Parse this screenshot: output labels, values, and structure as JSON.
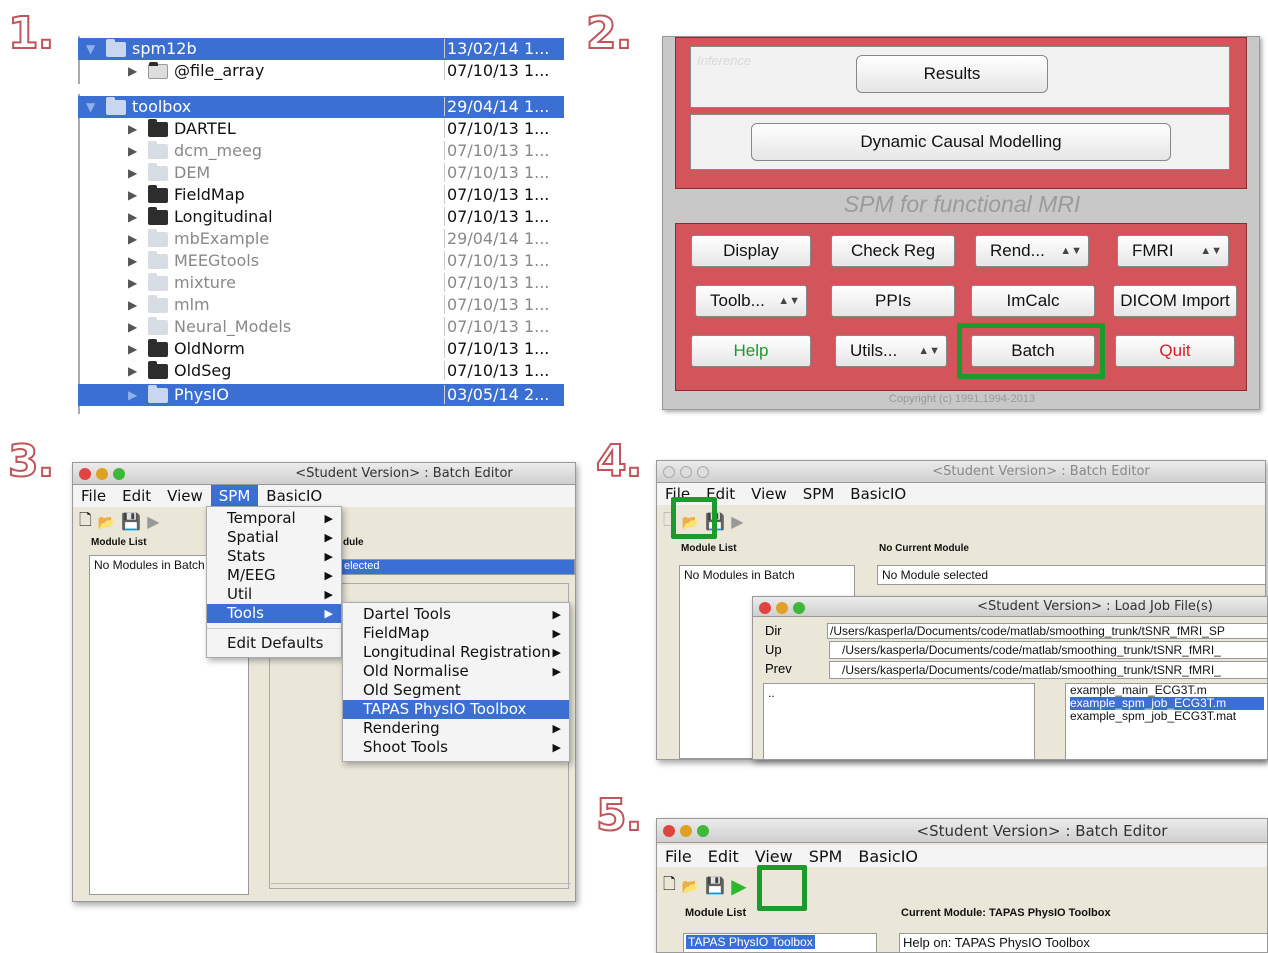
{
  "steps": [
    "1.",
    "2.",
    "3.",
    "4.",
    "5."
  ],
  "panel1": {
    "rows": [
      {
        "name": "spm12b",
        "date": "13/02/14 1...",
        "sel": true,
        "expanded": true,
        "indent": 0
      },
      {
        "name": "@file_array",
        "date": "07/10/13 1...",
        "indent": 1
      },
      {
        "name": "toolbox",
        "date": "29/04/14 1...",
        "sel": true,
        "expanded": true,
        "indent": 0
      },
      {
        "name": "DARTEL",
        "date": "07/10/13 1...",
        "indent": 1
      },
      {
        "name": "dcm_meeg",
        "date": "07/10/13 1...",
        "indent": 1,
        "dim": true
      },
      {
        "name": "DEM",
        "date": "07/10/13 1...",
        "indent": 1,
        "dim": true
      },
      {
        "name": "FieldMap",
        "date": "07/10/13 1...",
        "indent": 1
      },
      {
        "name": "Longitudinal",
        "date": "07/10/13 1...",
        "indent": 1
      },
      {
        "name": "mbExample",
        "date": "29/04/14 1...",
        "indent": 1,
        "dim": true
      },
      {
        "name": "MEEGtools",
        "date": "07/10/13 1...",
        "indent": 1,
        "dim": true
      },
      {
        "name": "mixture",
        "date": "07/10/13 1...",
        "indent": 1,
        "dim": true
      },
      {
        "name": "mlm",
        "date": "07/10/13 1...",
        "indent": 1,
        "dim": true
      },
      {
        "name": "Neural_Models",
        "date": "07/10/13 1...",
        "indent": 1,
        "dim": true
      },
      {
        "name": "OldNorm",
        "date": "07/10/13 1...",
        "indent": 1
      },
      {
        "name": "OldSeg",
        "date": "07/10/13 1...",
        "indent": 1
      },
      {
        "name": "PhysIO",
        "date": "03/05/14 2...",
        "indent": 1,
        "sel": true
      }
    ]
  },
  "panel2": {
    "inference_label": "Inference",
    "results": "Results",
    "dcm": "Dynamic Causal Modelling",
    "section_title": "SPM for functional MRI",
    "buttons": {
      "display": "Display",
      "checkreg": "Check Reg",
      "rend": "Rend...",
      "fmri": "FMRI",
      "toolb": "Toolb...",
      "ppis": "PPIs",
      "imcalc": "ImCalc",
      "dicom": "DICOM Import",
      "help": "Help",
      "utils": "Utils...",
      "batch": "Batch",
      "quit": "Quit"
    },
    "copyright": "Copyright (c) 1991,1994-2013"
  },
  "window_title": "<Student Version> : Batch Editor",
  "menus": {
    "file": "File",
    "edit": "Edit",
    "view": "View",
    "spm": "SPM",
    "basicio": "BasicIO"
  },
  "panel3": {
    "module_list": "Module List",
    "no_modules": "No Modules in Batch",
    "dule": "dule",
    "elected": "elected",
    "spm_menu": [
      "Temporal",
      "Spatial",
      "Stats",
      "M/EEG",
      "Util",
      "Tools"
    ],
    "edit_defaults": "Edit Defaults",
    "tools_menu": [
      "Dartel Tools",
      "FieldMap",
      "Longitudinal Registration",
      "Old Normalise",
      "Old Segment",
      "TAPAS PhysIO Toolbox",
      "Rendering",
      "Shoot Tools"
    ]
  },
  "panel4": {
    "module_list": "Module List",
    "no_current": "No Current Module",
    "no_modules": "No Modules in Batch",
    "no_selected": "No Module selected",
    "load_title": "<Student Version> : Load Job File(s)",
    "dir": "Dir",
    "up": "Up",
    "prev": "Prev",
    "path1": "/Users/kasperla/Documents/code/matlab/smoothing_trunk/tSNR_fMRI_SP",
    "path2": "/Users/kasperla/Documents/code/matlab/smoothing_trunk/tSNR_fMRI_",
    "path3": "/Users/kasperla/Documents/code/matlab/smoothing_trunk/tSNR_fMRI_",
    "dotdot": "..",
    "files": [
      "example_main_ECG3T.m",
      "example_spm_job_ECG3T.m",
      "example_spm_job_ECG3T.mat"
    ]
  },
  "panel5": {
    "module_list": "Module List",
    "current": "Current Module: TAPAS PhysIO Toolbox",
    "module": "TAPAS PhysIO Toolbox",
    "help": "Help on: TAPAS PhysIO Toolbox"
  }
}
